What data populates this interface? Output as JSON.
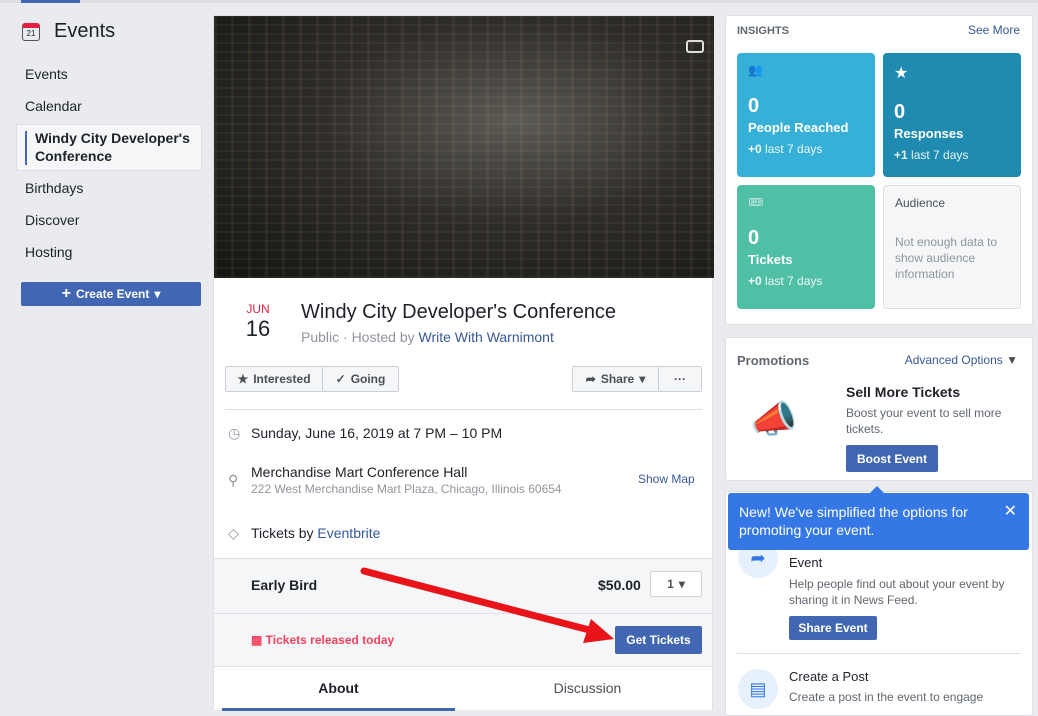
{
  "sidebar": {
    "title": "Events",
    "calendar_day": "21",
    "items": [
      "Events",
      "Calendar",
      "Windy City Developer's Conference",
      "Birthdays",
      "Discover",
      "Hosting"
    ],
    "create_label": "Create Event"
  },
  "event": {
    "month": "JUN",
    "day": "16",
    "title": "Windy City Developer's Conference",
    "privacy": "Public · Hosted by ",
    "host": "Write With Warnimont",
    "interested": "Interested",
    "going": "Going",
    "share": "Share",
    "more": "···",
    "datetime": "Sunday, June 16, 2019 at 7 PM – 10 PM",
    "venue": "Merchandise Mart Conference Hall",
    "address": "222 West Merchandise Mart Plaza, Chicago, Illinois 60654",
    "show_map": "Show Map",
    "tickets_by": "Tickets by ",
    "ticket_provider": "Eventbrite",
    "ticket_name": "Early Bird",
    "ticket_price": "$50.00",
    "quantity": "1",
    "released": "Tickets released today",
    "get_tickets": "Get Tickets",
    "tabs": [
      "About",
      "Discussion"
    ]
  },
  "insights": {
    "title": "INSIGHTS",
    "see_more": "See More",
    "tiles": [
      {
        "value": "0",
        "label": "People Reached",
        "delta": "+0",
        "period": " last 7 days",
        "color": "#36b0d6"
      },
      {
        "value": "0",
        "label": "Responses",
        "delta": "+1",
        "period": " last 7 days",
        "color": "#1f8bb1"
      },
      {
        "value": "0",
        "label": "Tickets",
        "delta": "+0",
        "period": " last 7 days",
        "color": "#4fbfa6"
      }
    ],
    "audience": {
      "title": "Audience",
      "text": "Not enough data to show audience information"
    }
  },
  "promotions": {
    "title": "Promotions",
    "advanced": "Advanced Options",
    "heading": "Sell More Tickets",
    "text": "Boost your event to sell more tickets.",
    "button": "Boost Event"
  },
  "tooltip": {
    "text": "New! We've simplified the options for promoting your event."
  },
  "share_event": {
    "title": "Event",
    "text": "Help people find out about your event by sharing it in News Feed.",
    "button": "Share Event"
  },
  "create_post": {
    "title": "Create a Post",
    "text": "Create a post in the event to engage"
  }
}
